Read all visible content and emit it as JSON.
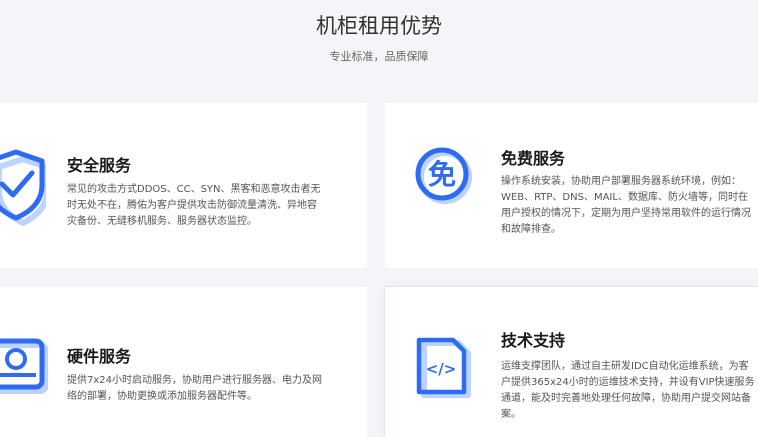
{
  "section": {
    "title": "机柜租用优势",
    "subtitle": "专业标准，品质保障"
  },
  "cards": [
    {
      "title": "安全服务",
      "desc": "常见的攻击方式DDOS、CC、SYN、黑客和恶意攻击者无时无处不在，腾佑为客户提供攻击防御流量清洗、异地容灾备份、无缝移机服务、服务器状态监控。",
      "icon": "shield-check-icon"
    },
    {
      "title": "免费服务",
      "desc": "操作系统安装，协助用户部署服务器系统环境，例如：WEB、RTP、DNS、MAIL、数据库、防火墙等，同时在用户授权的情况下，定期为用户坚持常用软件的运行情况和故障排查。",
      "icon": "free-badge-icon",
      "icon_char": "免"
    },
    {
      "title": "硬件服务",
      "desc": "提供7x24小时启动服务，协助用户进行服务器、电力及网络的部署，协助更换或添加服务器配件等。",
      "icon": "hard-drive-icon"
    },
    {
      "title": "技术支持",
      "desc": "运维支撑团队，通过自主研发IDC自动化运维系统，为客户提供365x24小时的运维技术支持，并设有VIP快速服务通道，能及时完善地处理任何故障，协助用户提交网站备案。",
      "icon": "code-document-icon",
      "icon_char": "</>"
    }
  ],
  "colors": {
    "accent": "#2f6bf2",
    "accent_light": "#bcd2ff",
    "background": "#f4f5f8",
    "card": "#ffffff"
  }
}
